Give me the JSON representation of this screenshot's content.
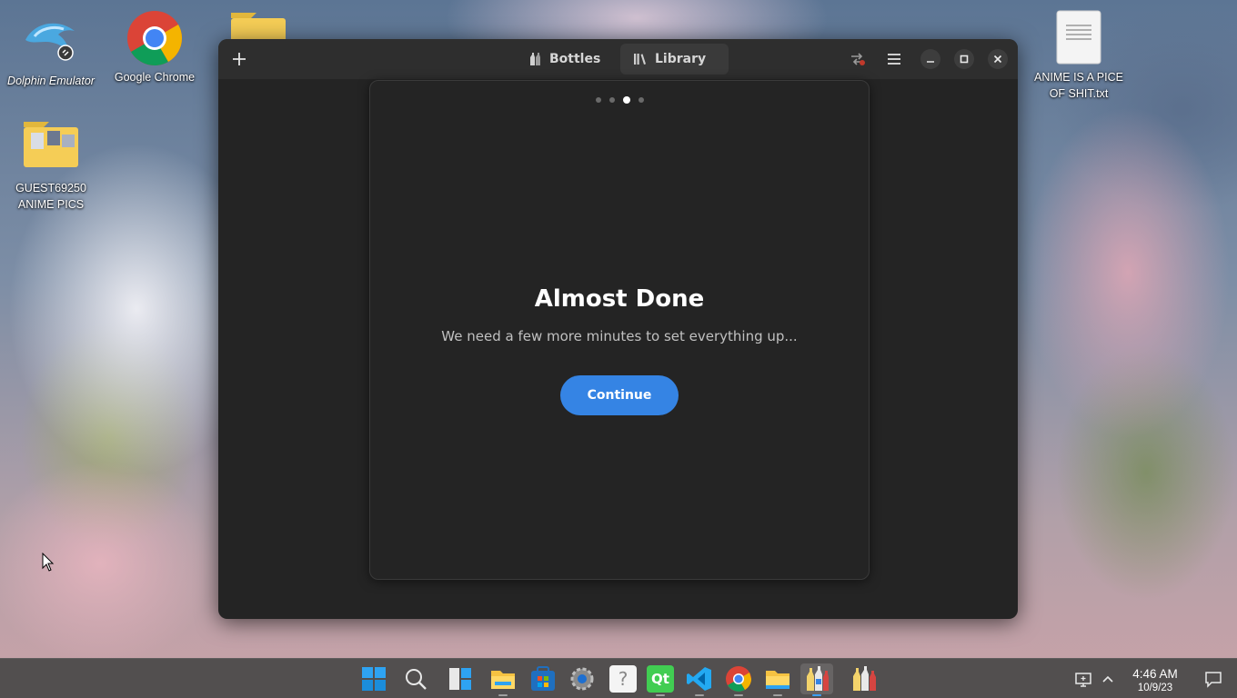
{
  "desktop": {
    "icons": [
      {
        "label": "Dolphin Emulator"
      },
      {
        "label": "Google Chrome"
      },
      {
        "label": "GUEST69250 ANIME PICS"
      },
      {
        "label": "ANIME IS A PICE OF SHIT.txt"
      }
    ]
  },
  "window": {
    "tabs": [
      {
        "label": "Bottles",
        "icon": "bottles-icon"
      },
      {
        "label": "Library",
        "icon": "library-icon"
      }
    ],
    "add_button": "add-icon",
    "menu_button": "hamburger-menu-icon"
  },
  "dialog": {
    "page_count": 4,
    "current_page": 3,
    "title": "Almost Done",
    "subtitle": "We need a few more minutes to set everything up...",
    "continue_label": "Continue",
    "accent": "#3584e4"
  },
  "taskbar": {
    "apps": [
      "start",
      "search",
      "widgets",
      "file-explorer",
      "microsoft-store",
      "settings",
      "help",
      "qt-creator",
      "vscode",
      "google-chrome",
      "files",
      "bottles",
      "bottles-alt"
    ],
    "qt_label": "Qt",
    "help_label": "?",
    "time": "4:46 AM",
    "date": "10/9/23"
  }
}
